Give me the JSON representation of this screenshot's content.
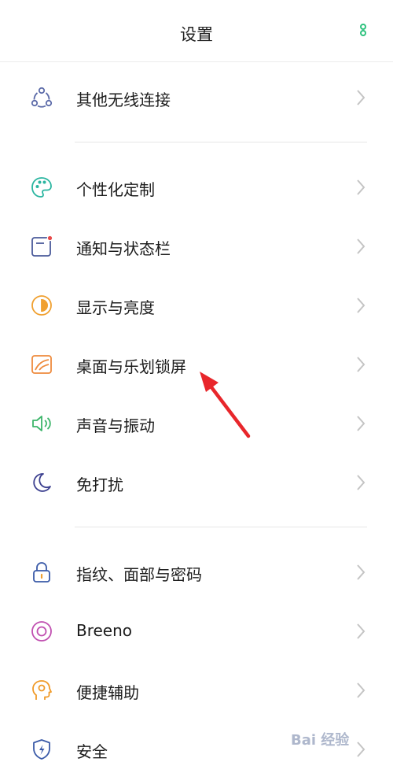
{
  "header": {
    "title": "设置"
  },
  "groups": [
    {
      "items": [
        {
          "label": "其他无线连接",
          "icon": "wireless-connection-icon"
        }
      ]
    },
    {
      "items": [
        {
          "label": "个性化定制",
          "icon": "palette-icon"
        },
        {
          "label": "通知与状态栏",
          "icon": "notification-icon"
        },
        {
          "label": "显示与亮度",
          "icon": "brightness-icon"
        },
        {
          "label": "桌面与乐划锁屏",
          "icon": "wallpaper-icon"
        },
        {
          "label": "声音与振动",
          "icon": "speaker-icon"
        },
        {
          "label": "免打扰",
          "icon": "moon-icon"
        }
      ]
    },
    {
      "items": [
        {
          "label": "指纹、面部与密码",
          "icon": "lock-icon"
        },
        {
          "label": "Breeno",
          "icon": "breeno-icon"
        },
        {
          "label": "便捷辅助",
          "icon": "assist-head-icon"
        },
        {
          "label": "安全",
          "icon": "shield-icon"
        }
      ]
    }
  ],
  "colors": {
    "accent_green": "#2ec27e",
    "arrow_red": "#e8262b"
  },
  "watermark": {
    "text": "Bai 经验"
  }
}
